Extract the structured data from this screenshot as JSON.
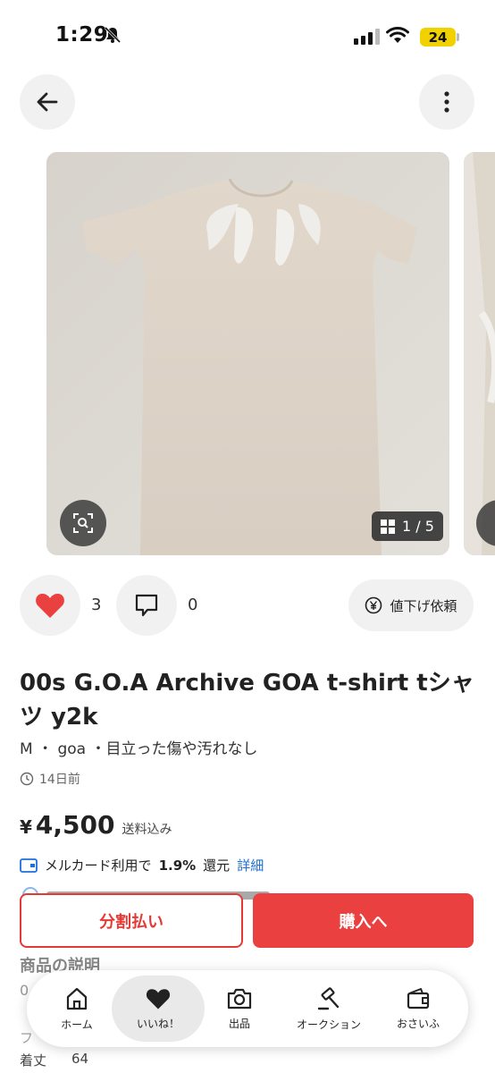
{
  "status_bar": {
    "time": "1:29",
    "battery": "24"
  },
  "carousel": {
    "counter": "1 / 5"
  },
  "reactions": {
    "likes": "3",
    "comments": "0",
    "price_down_label": "値下げ依頼"
  },
  "item": {
    "title": "00s G.O.A Archive GOA t-shirt tシャツ y2k",
    "subtitle": "M ・ goa ・目立った傷や汚れなし",
    "time_ago": "14日前",
    "price_yen": "¥",
    "price": "4,500",
    "shipping": "送料込み"
  },
  "merpay": {
    "text_prefix": "メルカード利用で",
    "rate": "1.9%",
    "text_suffix": "還元",
    "detail_link": "詳細"
  },
  "actions": {
    "split_pay": "分割払い",
    "buy": "購入へ"
  },
  "description": {
    "heading": "商品の説明",
    "line_start": "0",
    "spec_label": "着丈",
    "spec_value": "64",
    "partial_label": "フ"
  },
  "tabbar": {
    "home": "ホーム",
    "likes": "いいね！",
    "sell": "出品",
    "auction": "オークション",
    "wallet": "おさいふ"
  },
  "colors": {
    "accent_red": "#ea4040",
    "link_blue": "#1e6fd9"
  }
}
